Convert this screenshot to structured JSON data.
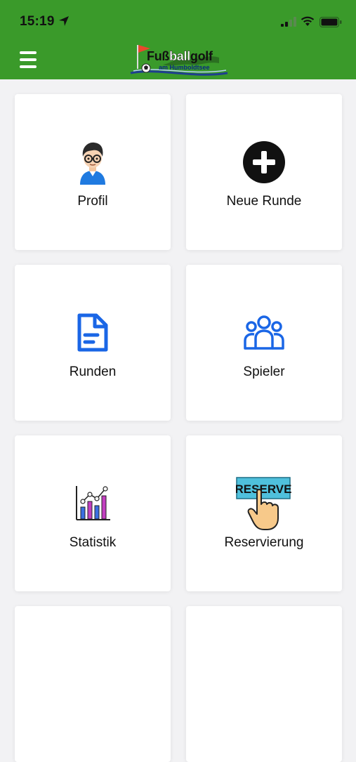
{
  "status_bar": {
    "time": "15:19"
  },
  "header": {
    "logo": {
      "word1": "Fuß",
      "word2": "ball",
      "word3": "golf",
      "subtitle": "am Humboldtsee"
    },
    "accent_color": "#3a9a2a"
  },
  "tiles": [
    {
      "label": "Profil",
      "icon": "profile-avatar-icon"
    },
    {
      "label": "Neue Runde",
      "icon": "plus-circle-icon"
    },
    {
      "label": "Runden",
      "icon": "document-icon"
    },
    {
      "label": "Spieler",
      "icon": "users-group-icon"
    },
    {
      "label": "Statistik",
      "icon": "chart-icon"
    },
    {
      "label": "Reservierung",
      "icon": "reserve-hand-icon"
    }
  ],
  "reservation_icon_text": "RESERVE"
}
